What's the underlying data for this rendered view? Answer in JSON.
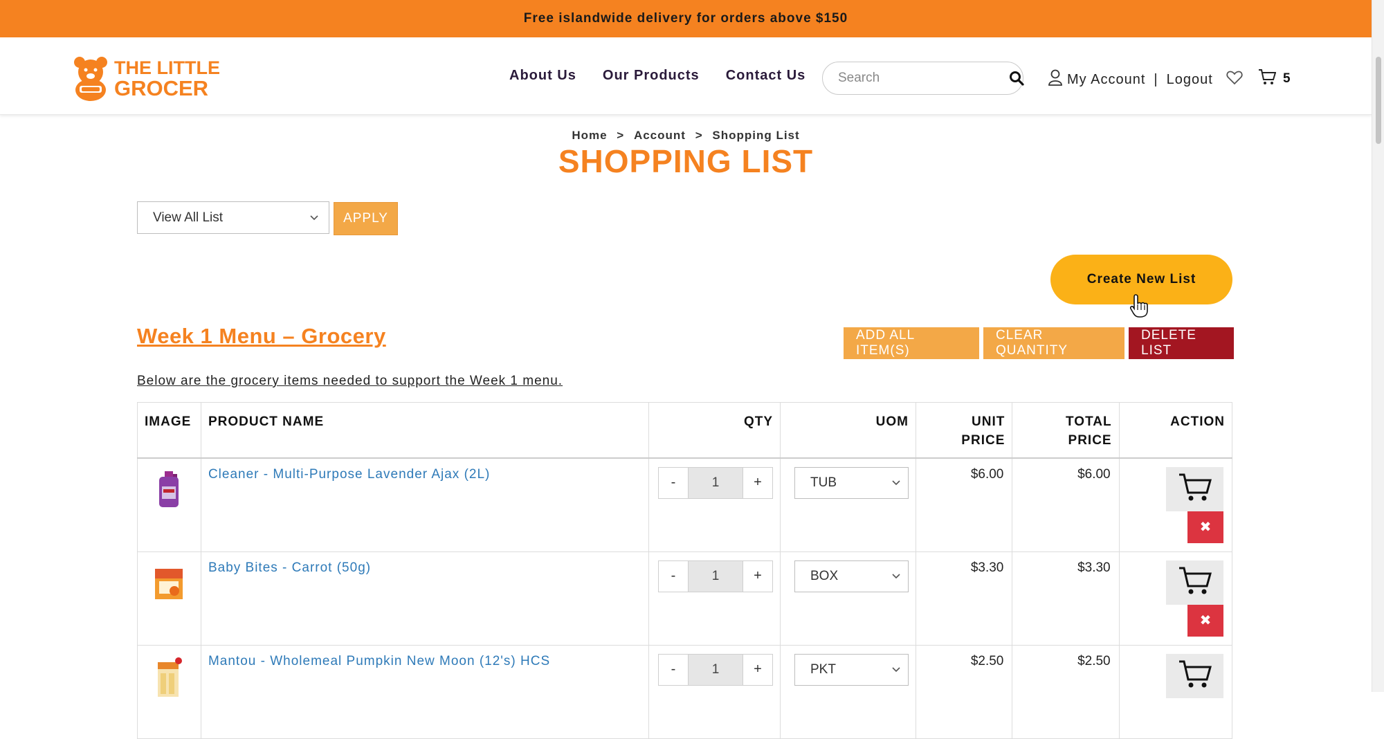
{
  "promo": {
    "text": "Free islandwide delivery for orders above $150"
  },
  "header": {
    "logo_line1": "THE LITTLE",
    "logo_line2": "GROCER",
    "nav": [
      "About Us",
      "Our Products",
      "Contact Us"
    ],
    "search_placeholder": "Search",
    "account_label": "My Account",
    "logout_label": "Logout",
    "account_sep": "|",
    "cart_count": "5"
  },
  "breadcrumb": {
    "items": [
      "Home",
      "Account",
      "Shopping List"
    ],
    "sep": ">"
  },
  "page_title": "SHOPPING LIST",
  "filter": {
    "selected": "View All List",
    "apply_label": "APPLY"
  },
  "create_label": "Create New List",
  "list": {
    "title": "Week 1 Menu – Grocery",
    "description": "Below are the grocery items needed to support the Week 1 menu.",
    "add_all_label": "ADD ALL ITEM(S)",
    "clear_qty_label": "CLEAR QUANTITY",
    "delete_label": "DELETE LIST"
  },
  "table": {
    "headers": {
      "image": "IMAGE",
      "product": "PRODUCT NAME",
      "qty": "QTY",
      "uom": "UOM",
      "unit_price_1": "UNIT",
      "unit_price_2": "PRICE",
      "total_price_1": "TOTAL",
      "total_price_2": "PRICE",
      "action": "ACTION"
    },
    "rows": [
      {
        "name": "Cleaner - Multi-Purpose Lavender Ajax (2L)",
        "qty": "1",
        "uom": "TUB",
        "unit_price": "$6.00",
        "total_price": "$6.00"
      },
      {
        "name": "Baby Bites - Carrot (50g)",
        "qty": "1",
        "uom": "BOX",
        "unit_price": "$3.30",
        "total_price": "$3.30"
      },
      {
        "name": "Mantou - Wholemeal Pumpkin New Moon (12's) HCS",
        "qty": "1",
        "uom": "PKT",
        "unit_price": "$2.50",
        "total_price": "$2.50"
      }
    ],
    "minus": "-",
    "plus": "+",
    "remove_glyph": "✖"
  },
  "colors": {
    "brand_orange": "#f58220",
    "button_amber": "#f3a847",
    "create_yellow": "#fbb117",
    "delete_red": "#a31621",
    "remove_red": "#dc3440",
    "link_blue": "#2e7ab8"
  },
  "icons": [
    "bear-logo-icon",
    "search-icon",
    "user-icon",
    "heart-icon",
    "cart-icon",
    "chevron-down-icon",
    "hand-pointer-icon",
    "close-icon"
  ]
}
